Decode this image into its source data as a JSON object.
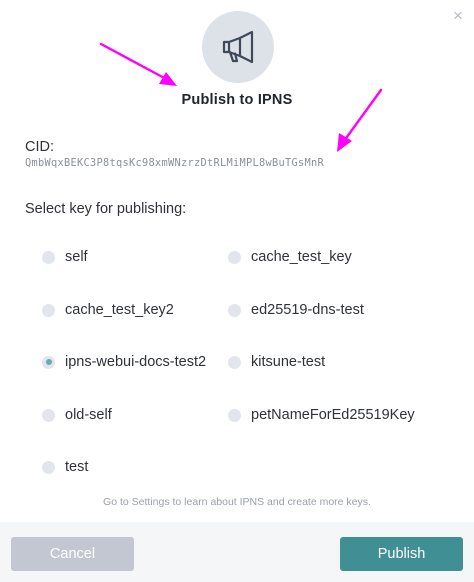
{
  "dialog": {
    "close_glyph": "×",
    "title": "Publish to IPNS",
    "icon": "megaphone-icon",
    "cid_label": "CID:",
    "cid_value": "QmbWqxBEKC3P8tqsKc98xmWNzrzDtRLMiMPL8wBuTGsMnR",
    "select_label": "Select key for publishing:",
    "hint": "Go to Settings to learn about IPNS and create more keys."
  },
  "keys": {
    "left": [
      {
        "label": "self",
        "checked": false
      },
      {
        "label": "cache_test_key2",
        "checked": false
      },
      {
        "label": "ipns-webui-docs-test2",
        "checked": true
      },
      {
        "label": "old-self",
        "checked": false
      },
      {
        "label": "test",
        "checked": false
      }
    ],
    "right": [
      {
        "label": "cache_test_key",
        "checked": false
      },
      {
        "label": "ed25519-dns-test",
        "checked": false
      },
      {
        "label": "kitsune-test",
        "checked": false
      },
      {
        "label": "petNameForEd25519Key",
        "checked": false
      }
    ]
  },
  "buttons": {
    "cancel": "Cancel",
    "publish": "Publish"
  },
  "colors": {
    "accent": "#3f8f95",
    "cancel_bg": "#c2c7d2",
    "annotation_arrow": "#ff00ff",
    "radio_checked": "#6aaab7"
  }
}
